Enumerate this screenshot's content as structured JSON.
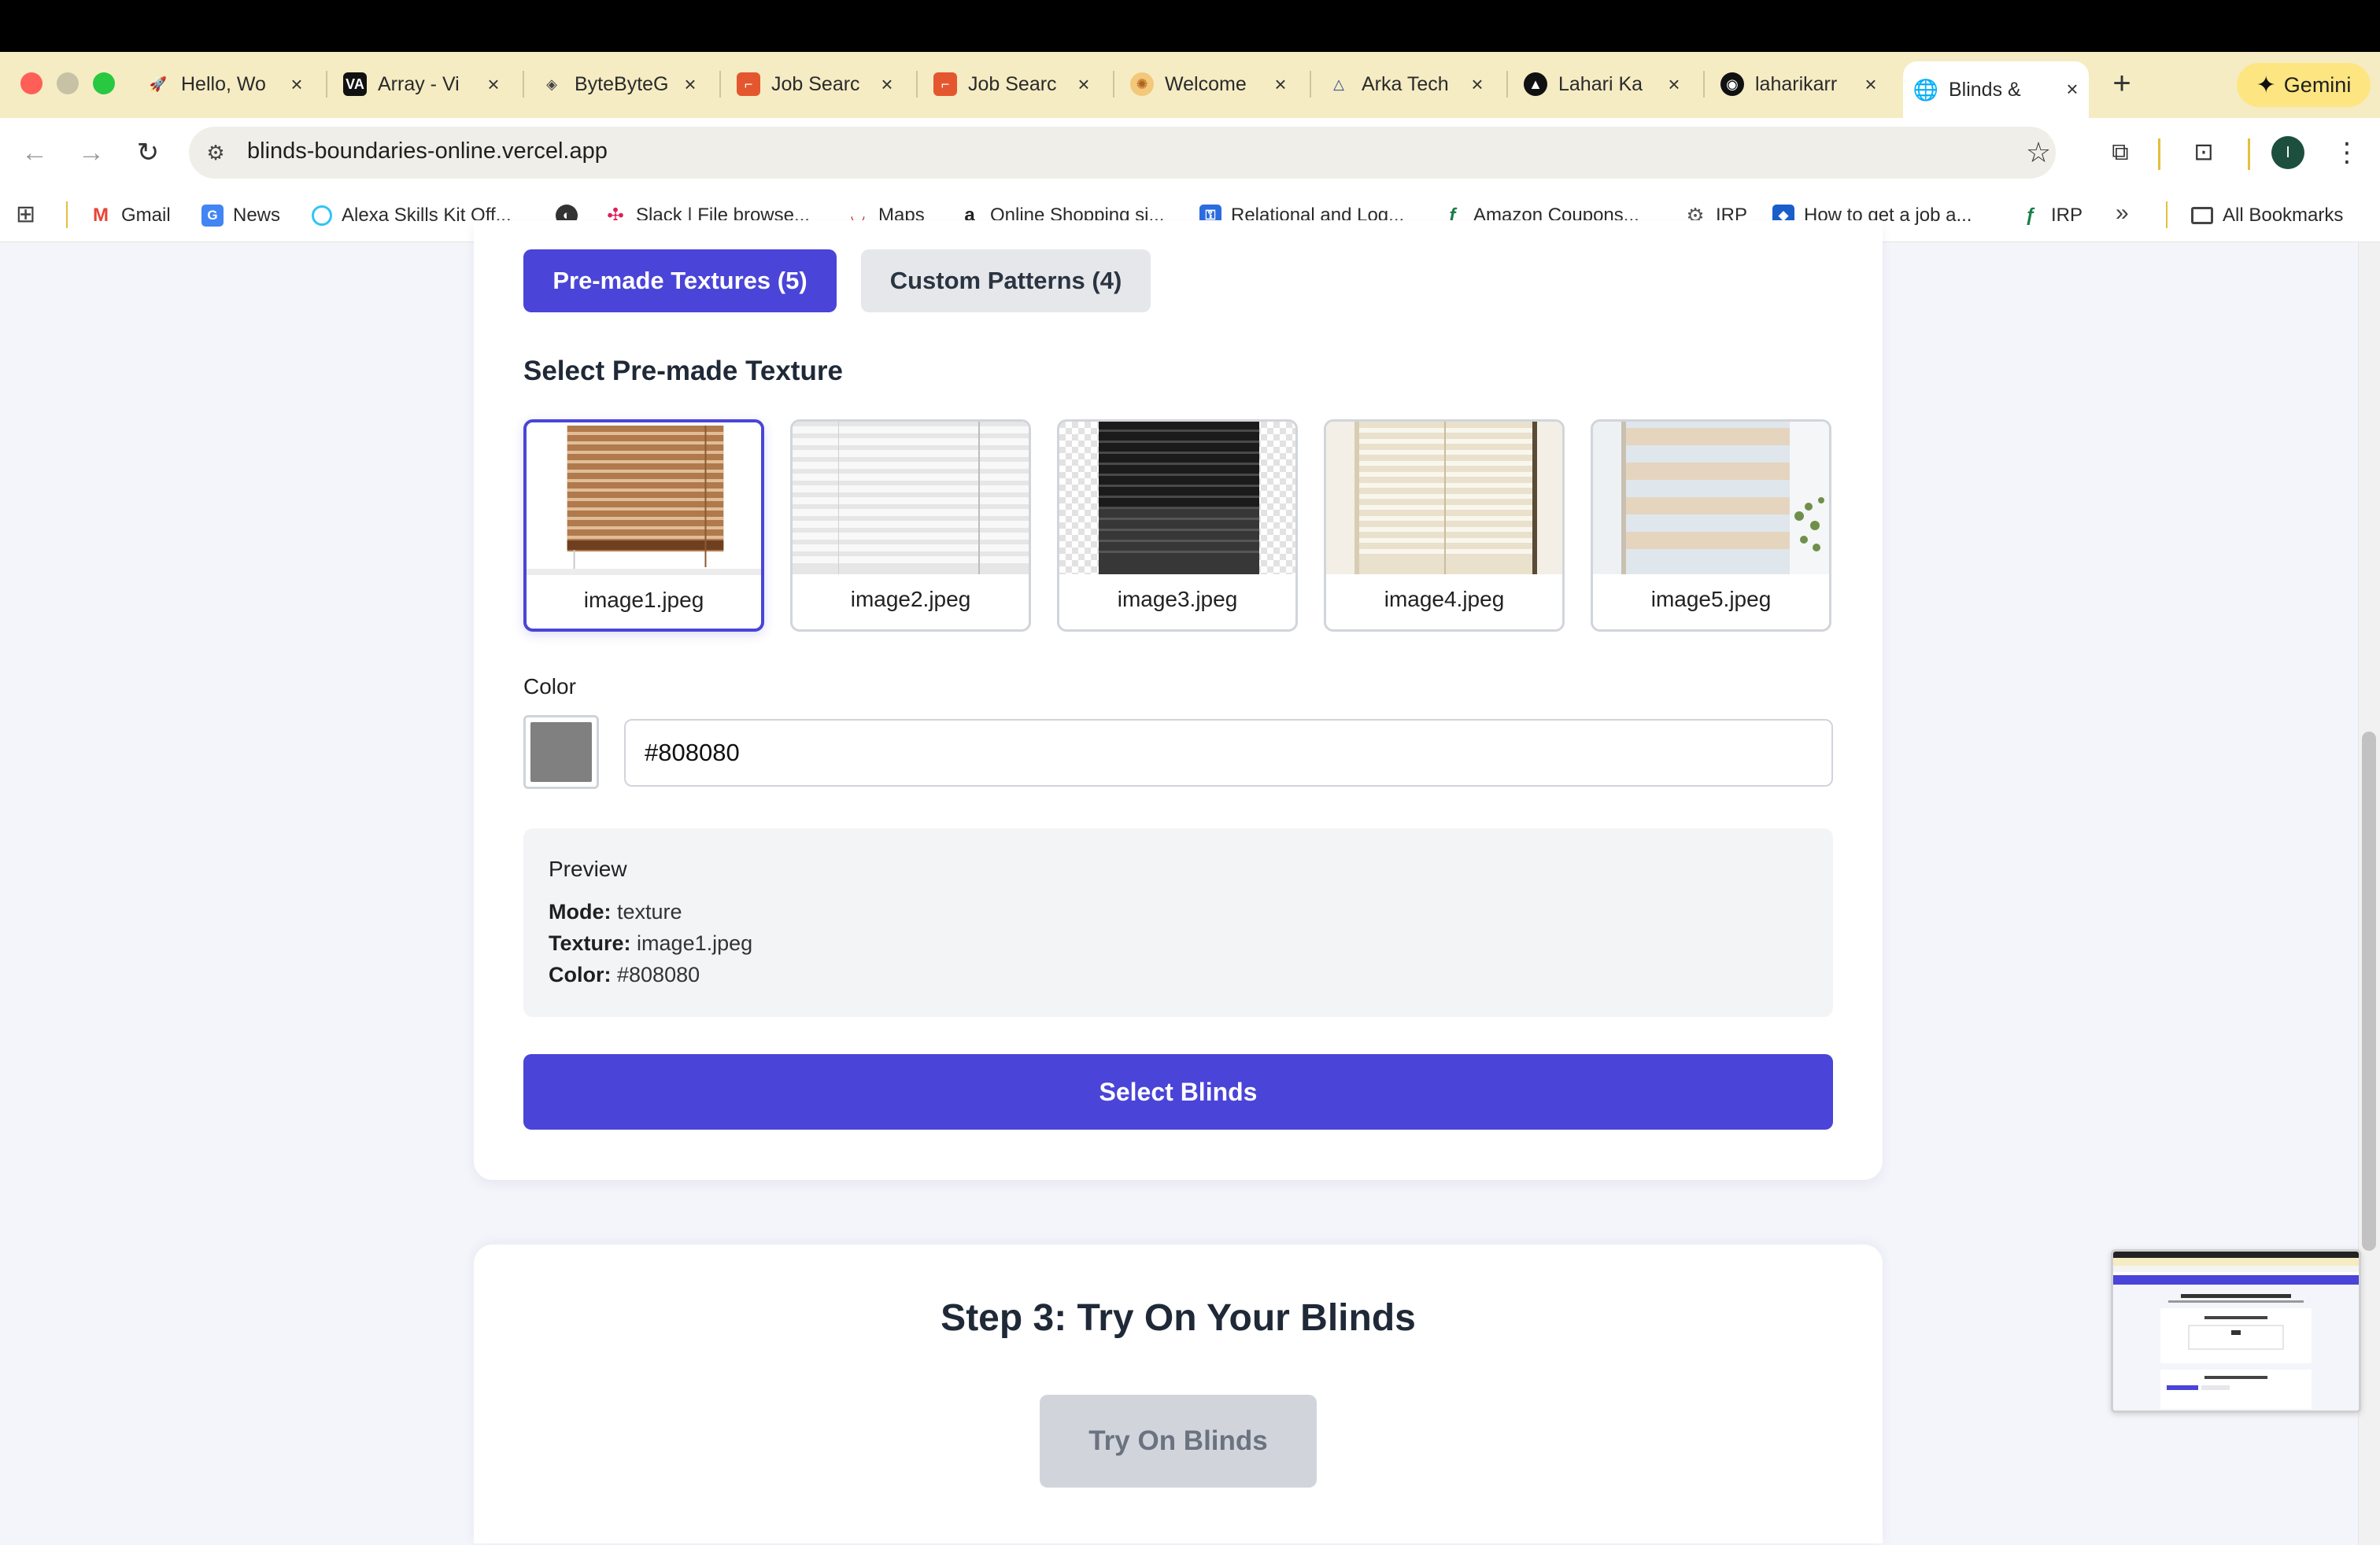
{
  "browser": {
    "tabs": [
      {
        "title": "Hello, Wo",
        "favicon": "rocket-icon",
        "color": "#6b6bd6"
      },
      {
        "title": "Array - Vi",
        "favicon": "va-logo-icon",
        "color": "#111111"
      },
      {
        "title": "ByteByteG",
        "favicon": "bytebytego-icon",
        "color": "#444444"
      },
      {
        "title": "Job Searc",
        "favicon": "job-search-icon",
        "color": "#e4572e"
      },
      {
        "title": "Job Searc",
        "favicon": "job-search-icon",
        "color": "#e4572e"
      },
      {
        "title": "Welcome",
        "favicon": "sun-icon",
        "color": "#e0a030"
      },
      {
        "title": "Arka Tech",
        "favicon": "arka-logo-icon",
        "color": "#2c4b8a"
      },
      {
        "title": "Lahari Ka",
        "favicon": "triangle-icon",
        "color": "#111111"
      },
      {
        "title": "laharikarr",
        "favicon": "github-icon",
        "color": "#111111"
      },
      {
        "title": "Blinds & B",
        "favicon": "globe-icon",
        "color": "#555555"
      }
    ],
    "new_tab_symbol": "+",
    "gemini_label": "Gemini",
    "url": "blinds-boundaries-online.vercel.app",
    "profile_initial": "I",
    "bookmarks": [
      {
        "label": "Gmail",
        "icon": "gmail-icon",
        "color": "#ea4335"
      },
      {
        "label": "News",
        "icon": "google-news-icon",
        "color": "#4285f4"
      },
      {
        "label": "Alexa Skills Kit Off...",
        "icon": "alexa-icon",
        "color": "#31c4f3"
      },
      {
        "label": "",
        "icon": "globe-icon",
        "color": "#333333"
      },
      {
        "label": "Slack | File browse...",
        "icon": "slack-icon",
        "color": "#611f69"
      },
      {
        "label": "Maps",
        "icon": "lips-icon",
        "color": "#c0392b"
      },
      {
        "label": "Online Shopping si...",
        "icon": "amazon-icon",
        "color": "#222222"
      },
      {
        "label": "Relational and Log...",
        "icon": "key-icon",
        "color": "#2d6cdf"
      },
      {
        "label": "Amazon Coupons...",
        "icon": "bookmark-f-icon",
        "color": "#1b7f4a"
      },
      {
        "label": "IRP",
        "icon": "gear-seal-icon",
        "color": "#555555"
      },
      {
        "label": "How to get a job a...",
        "icon": "chase-icon",
        "color": "#1a5fc9"
      },
      {
        "label": "IRP",
        "icon": "bookmark-f-icon",
        "color": "#1b7f4a"
      }
    ],
    "bookmarks_more": "»",
    "all_bookmarks_label": "All Bookmarks"
  },
  "page": {
    "mode_tabs": {
      "premade": "Pre-made Textures (5)",
      "custom": "Custom Patterns (4)"
    },
    "section_heading": "Select Pre-made Texture",
    "textures": [
      {
        "name": "image1.jpeg",
        "selected": true
      },
      {
        "name": "image2.jpeg",
        "selected": false
      },
      {
        "name": "image3.jpeg",
        "selected": false
      },
      {
        "name": "image4.jpeg",
        "selected": false
      },
      {
        "name": "image5.jpeg",
        "selected": false
      }
    ],
    "color_label": "Color",
    "color_value": "#808080",
    "preview": {
      "title": "Preview",
      "mode_label": "Mode:",
      "mode_value": "texture",
      "texture_label": "Texture:",
      "texture_value": "image1.jpeg",
      "color_label": "Color:",
      "color_value": "#808080"
    },
    "select_button": "Select Blinds",
    "step3_heading": "Step 3: Try On Your Blinds",
    "try_on_button": "Try On Blinds"
  },
  "colors": {
    "accent": "#4a44d8",
    "tabstrip": "#f5ecc4",
    "disabled_button": "#d1d5db"
  }
}
